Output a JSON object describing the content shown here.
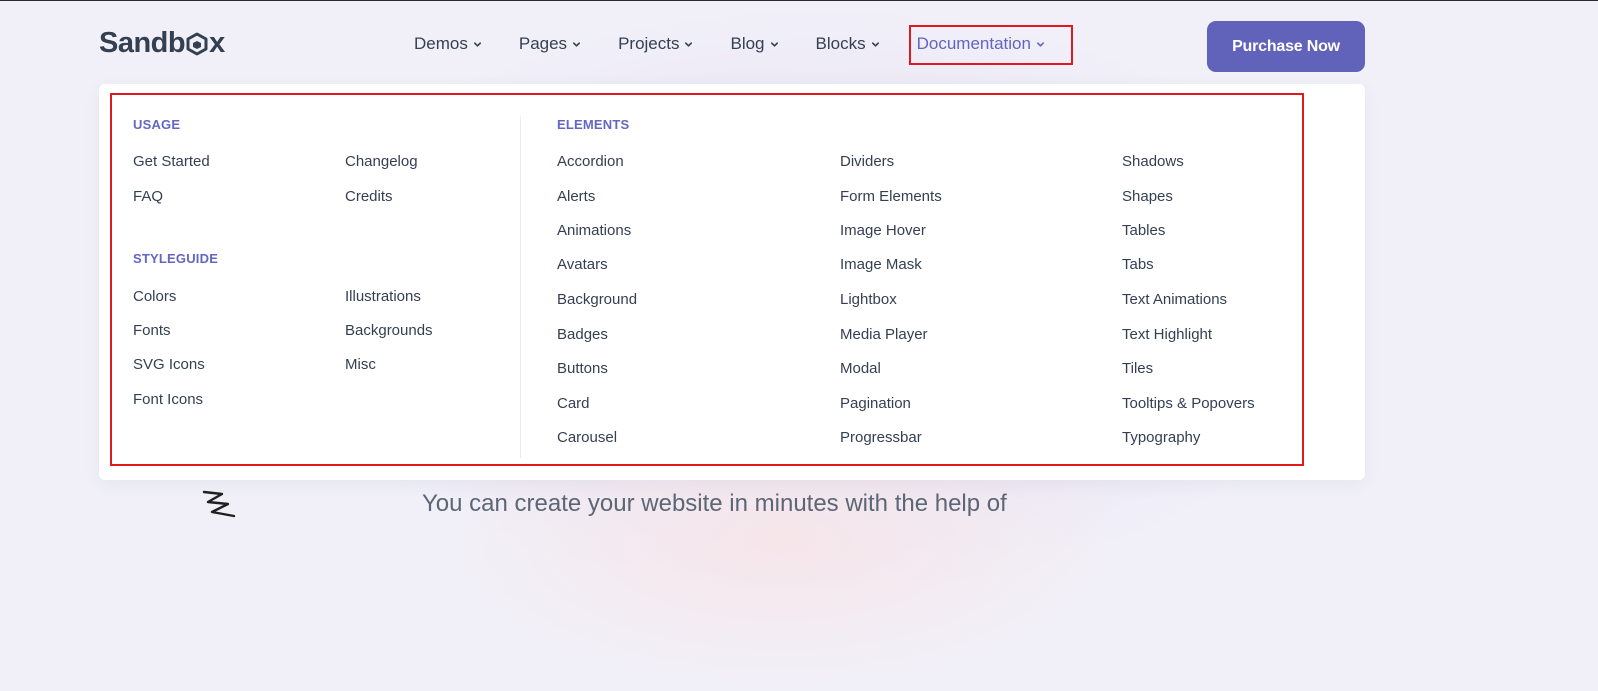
{
  "logo": {
    "text_before": "Sandb",
    "text_after": "x"
  },
  "nav": {
    "items": [
      {
        "label": "Demos"
      },
      {
        "label": "Pages"
      },
      {
        "label": "Projects"
      },
      {
        "label": "Blog"
      },
      {
        "label": "Blocks"
      },
      {
        "label": "Documentation",
        "active": true
      }
    ]
  },
  "purchase_label": "Purchase Now",
  "dropdown": {
    "usage": {
      "heading": "USAGE",
      "col1": [
        "Get Started",
        "FAQ"
      ],
      "col2": [
        "Changelog",
        "Credits"
      ]
    },
    "styleguide": {
      "heading": "STYLEGUIDE",
      "col1": [
        "Colors",
        "Fonts",
        "SVG Icons",
        "Font Icons"
      ],
      "col2": [
        "Illustrations",
        "Backgrounds",
        "Misc"
      ]
    },
    "elements": {
      "heading": "ELEMENTS",
      "col1": [
        "Accordion",
        "Alerts",
        "Animations",
        "Avatars",
        "Background",
        "Badges",
        "Buttons",
        "Card",
        "Carousel"
      ],
      "col2": [
        "Dividers",
        "Form Elements",
        "Image Hover",
        "Image Mask",
        "Lightbox",
        "Media Player",
        "Modal",
        "Pagination",
        "Progressbar"
      ],
      "col3": [
        "Shadows",
        "Shapes",
        "Tables",
        "Tabs",
        "Text Animations",
        "Text Highlight",
        "Tiles",
        "Tooltips & Popovers",
        "Typography"
      ]
    }
  },
  "hero": {
    "subtitle": "You can create your website in minutes with the help of"
  },
  "colors": {
    "accent": "#6162ba",
    "text": "#343f52",
    "highlight": "#e0191e"
  }
}
